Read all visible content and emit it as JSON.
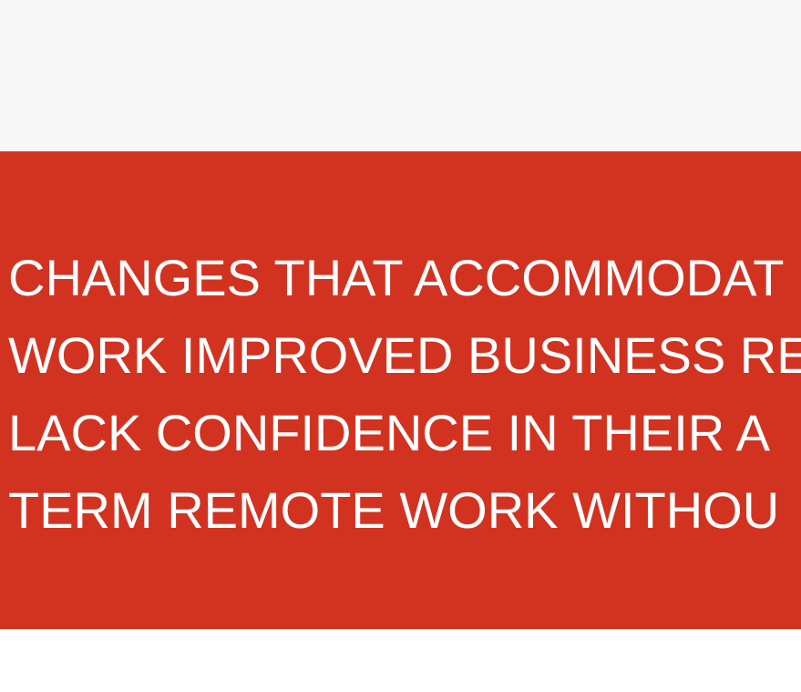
{
  "banner": {
    "quote_lines": [
      "CHANGES THAT ACCOMMODAT",
      "WORK IMPROVED BUSINESS RE",
      "LACK CONFIDENCE IN THEIR A",
      "TERM REMOTE WORK WITHOU"
    ]
  },
  "colors": {
    "banner_background": "#d23321",
    "top_background": "#f6f6f6",
    "text": "#ffffff"
  }
}
